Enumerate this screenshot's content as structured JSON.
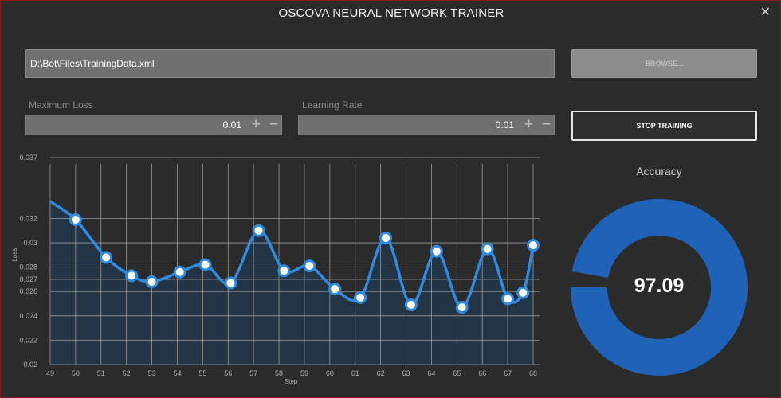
{
  "window": {
    "title": "OSCOVA NEURAL NETWORK TRAINER",
    "close_glyph": "✕"
  },
  "file": {
    "path": "D:\\Bot\\Files\\TrainingData.xml",
    "browse_label": "BROWSE..."
  },
  "max_loss": {
    "label": "Maximum Loss",
    "value": "0.01",
    "plus": "+",
    "minus": "−"
  },
  "learning_rate": {
    "label": "Learning Rate",
    "value": "0.01",
    "plus": "+",
    "minus": "−"
  },
  "stop_label": "STOP TRAINING",
  "accuracy": {
    "title": "Accuracy",
    "value": "97.09",
    "fraction": 0.9709,
    "ring_color": "#1e63b8",
    "track_color": "#2b2b2b"
  },
  "colors": {
    "line": "#2e8be0",
    "fill": "#233444",
    "grid": "#9a9a9a",
    "axis_text": "#b0b0b0"
  },
  "chart_data": {
    "type": "area",
    "xlabel": "Step",
    "ylabel": "Loss",
    "xlim": [
      49,
      68
    ],
    "ylim": [
      0.02,
      0.037
    ],
    "x_ticks": [
      49,
      50,
      51,
      52,
      53,
      54,
      55,
      56,
      57,
      58,
      59,
      60,
      61,
      62,
      63,
      64,
      65,
      66,
      67,
      68
    ],
    "y_ticks": [
      0.02,
      0.022,
      0.024,
      0.026,
      0.027,
      0.028,
      0.03,
      0.032,
      0.037
    ],
    "y_tick_labels": [
      "0.02",
      "0.022",
      "0.024",
      "0.026",
      "0.027",
      "0.028",
      "0.03",
      "0.032",
      "0.037"
    ],
    "grid": true,
    "start_point": {
      "x": 49,
      "y": 0.0334
    },
    "x": [
      50,
      51.2,
      52.2,
      53,
      54.1,
      55.1,
      56.1,
      57.2,
      58.2,
      59.2,
      60.2,
      61.2,
      62.2,
      63.2,
      64.2,
      65.2,
      66.2,
      67,
      67.6,
      68
    ],
    "y": [
      0.0319,
      0.0288,
      0.0273,
      0.0268,
      0.0276,
      0.0282,
      0.0267,
      0.031,
      0.0277,
      0.0281,
      0.0262,
      0.0255,
      0.0304,
      0.0249,
      0.0293,
      0.0247,
      0.0295,
      0.0254,
      0.0259,
      0.0298
    ]
  }
}
